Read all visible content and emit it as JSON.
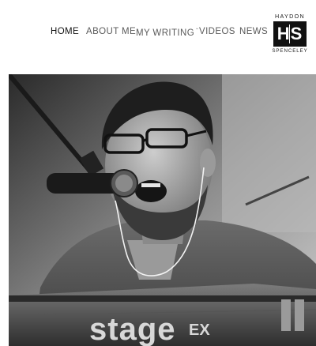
{
  "nav": {
    "items": [
      {
        "label": "HOME",
        "active": true
      },
      {
        "label": "ABOUT ME",
        "active": false
      },
      {
        "label": "MY WRITING",
        "active": false,
        "has_dropdown": true
      },
      {
        "label": "VIDEOS",
        "active": false
      },
      {
        "label": "NEWS",
        "active": false
      }
    ]
  },
  "logo": {
    "top_text": "HAYDON",
    "initials": "HS",
    "bottom_text": "SPENCELEY"
  },
  "hero": {
    "keyboard_brand": "stage",
    "keyboard_model": "EX",
    "icons": [
      "microphone-icon",
      "earphone-icon"
    ]
  }
}
